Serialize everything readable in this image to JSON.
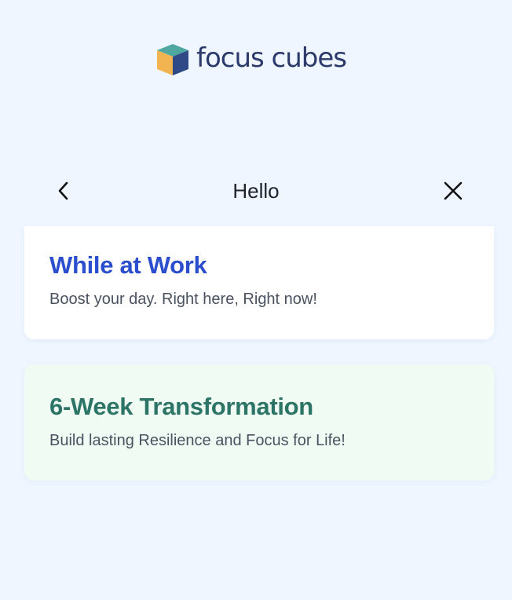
{
  "logo": {
    "text": "focus cubes",
    "icon": "cube-logo-icon",
    "colors": {
      "top": "#4fa8a0",
      "left": "#f2b450",
      "right": "#2f4a86",
      "text": "#2b3a6b"
    }
  },
  "header": {
    "title": "Hello",
    "back_icon": "chevron-left-icon",
    "close_icon": "close-icon"
  },
  "cards": [
    {
      "title": "While at Work",
      "subtitle": "Boost your day. Right here, Right now!",
      "accent": "#2b4ecf",
      "background": "#ffffff"
    },
    {
      "title": "6-Week Transformation",
      "subtitle": "Build lasting Resilience and Focus for Life!",
      "accent": "#2c7566",
      "background": "#f0fbf3"
    }
  ],
  "colors": {
    "page_background": "#eff6ff"
  }
}
